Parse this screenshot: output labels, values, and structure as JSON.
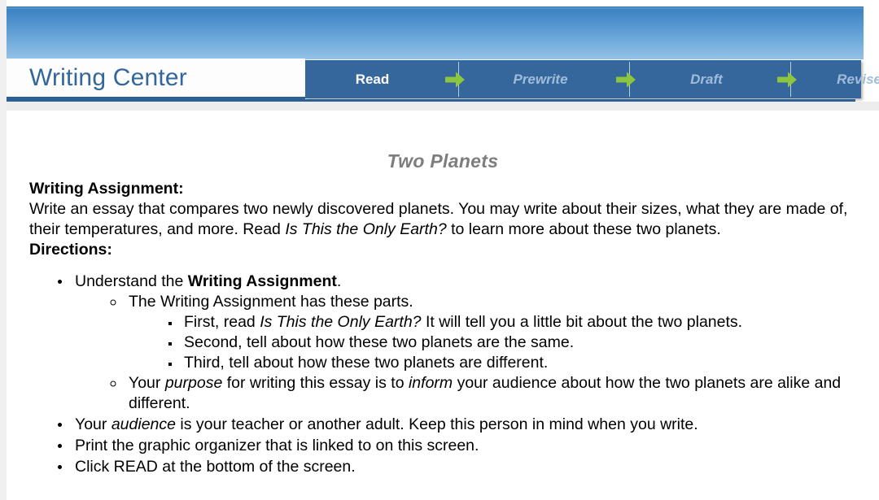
{
  "header": {
    "logo_text": "Writing Center",
    "nav_steps": [
      {
        "label": "Read",
        "state": "active"
      },
      {
        "label": "Prewrite",
        "state": "inactive"
      },
      {
        "label": "Draft",
        "state": "inactive"
      },
      {
        "label": "Revise/Edit",
        "state": "inactive"
      }
    ],
    "arrow_icon": "green-right-arrow",
    "colors": {
      "banner_top": "#3b80c0",
      "banner_bottom": "#93c2e7",
      "nav_background": "#35679d",
      "nav_active_text": "#ffffff",
      "nav_inactive_text": "#9fbdda",
      "arrow_green": "#8cc63f",
      "logo_text": "#336699",
      "rule": "#2c5f93"
    }
  },
  "content": {
    "title": "Two Planets",
    "title_color": "#7d7d7d",
    "assignment_heading": "Writing Assignment:",
    "assignment_para": {
      "part1": "Write an essay that compares two newly discovered planets. You may write about their sizes, what they are made of, their temperatures, and more. Read ",
      "italic_title": "Is This the Only Earth?",
      "part2": " to learn more about these two planets."
    },
    "directions_heading": "Directions:",
    "bullets": {
      "b1": {
        "pre": "Understand the ",
        "bold": "Writing Assignment",
        "post": "."
      },
      "b1_sub1": "The Writing Assignment has these parts.",
      "b1_sub1_items": {
        "i1": {
          "pre": "First, read ",
          "italic": "Is This the Only Earth?",
          "post": " It will tell you a little bit about the two planets."
        },
        "i2": "Second, tell about how these two planets are the same.",
        "i3": "Third, tell about how these two planets are different."
      },
      "b1_sub2": {
        "pre": "Your ",
        "italic1": "purpose",
        "mid": " for writing this essay is to ",
        "italic2": "inform",
        "post": " your audience about how the two planets are alike and different."
      },
      "b2": {
        "pre": "Your ",
        "italic": "audience",
        "post": " is your teacher or another adult. Keep this person in mind when you write."
      },
      "b3": "Print the graphic organizer that is linked to on this screen.",
      "b4": "Click READ at the bottom of the screen."
    }
  }
}
